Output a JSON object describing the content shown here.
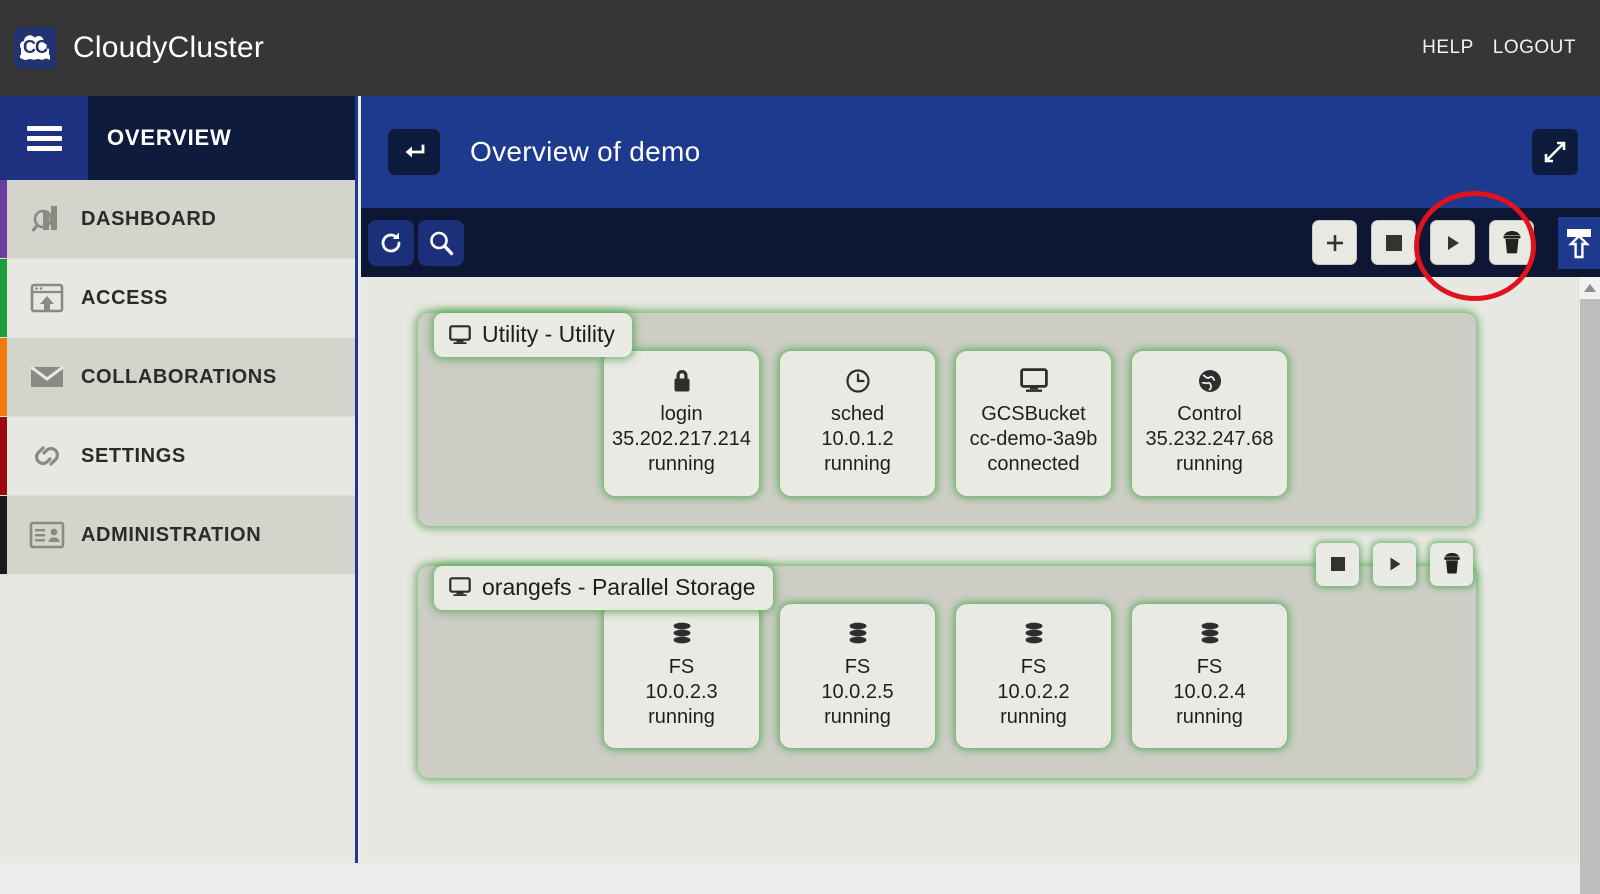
{
  "app": {
    "brand_name": "CloudyCluster",
    "logo_text": "CC",
    "logo_color": "#233270"
  },
  "topbar": {
    "help_label": "HELP",
    "logout_label": "LOGOUT",
    "background": "#363636"
  },
  "sidebar": {
    "menu_title": "OVERVIEW",
    "hamburger_icon": "hamburger-icon",
    "items": [
      {
        "label": "DASHBOARD",
        "icon": "dashboard-chart-magnifier-icon",
        "stripe": "#6b3fa0",
        "active": true
      },
      {
        "label": "ACCESS",
        "icon": "browser-upload-icon",
        "stripe": "#1f9e3c",
        "active": false
      },
      {
        "label": "COLLABORATIONS",
        "icon": "envelope-icon",
        "stripe": "#f07a10",
        "active": true
      },
      {
        "label": "SETTINGS",
        "icon": "chain-link-icon",
        "stripe": "#9c0a10",
        "active": false
      },
      {
        "label": "ADMINISTRATION",
        "icon": "id-card-icon",
        "stripe": "#1a1a1a",
        "active": true
      }
    ]
  },
  "page_header": {
    "title": "Overview of demo",
    "back_icon": "back-arrow-icon",
    "expand_icon": "expand-diagonal-icon",
    "background": "#1d3a8f"
  },
  "toolbar": {
    "background": "#0d1733",
    "left_buttons": [
      {
        "name": "refresh-button",
        "icon": "refresh-circular-arrow-icon"
      },
      {
        "name": "search-button",
        "icon": "search-magnifier-icon"
      }
    ],
    "right_buttons": [
      {
        "name": "add-button",
        "icon": "plus-icon",
        "label": "+"
      },
      {
        "name": "stop-button",
        "icon": "stop-square-icon"
      },
      {
        "name": "start-button",
        "icon": "play-triangle-icon"
      },
      {
        "name": "delete-button",
        "icon": "trash-can-icon",
        "highlighted": true
      }
    ],
    "upload_button": {
      "name": "upload-button",
      "icon": "upload-tray-icon"
    },
    "annotation": {
      "shape": "circle",
      "color": "#e1121b",
      "target": "delete-button"
    }
  },
  "panels": [
    {
      "tab_icon": "monitor-icon",
      "tab_label": "Utility - Utility",
      "actions": [],
      "nodes": [
        {
          "icon": "lock-icon",
          "name": "login",
          "address": "35.202.217.214",
          "status": "running"
        },
        {
          "icon": "clock-icon",
          "name": "sched",
          "address": "10.0.1.2",
          "status": "running"
        },
        {
          "icon": "monitor-icon",
          "name": "GCSBucket",
          "address": "cc-demo-3a9b",
          "status": "connected"
        },
        {
          "icon": "globe-icon",
          "name": "Control",
          "address": "35.232.247.68",
          "status": "running"
        }
      ]
    },
    {
      "tab_icon": "monitor-icon",
      "tab_label": "orangefs - Parallel Storage",
      "actions": [
        {
          "name": "panel-stop-button",
          "icon": "stop-square-icon"
        },
        {
          "name": "panel-start-button",
          "icon": "play-triangle-icon"
        },
        {
          "name": "panel-delete-button",
          "icon": "trash-can-icon"
        }
      ],
      "nodes": [
        {
          "icon": "database-stack-icon",
          "name": "FS",
          "address": "10.0.2.3",
          "status": "running"
        },
        {
          "icon": "database-stack-icon",
          "name": "FS",
          "address": "10.0.2.5",
          "status": "running"
        },
        {
          "icon": "database-stack-icon",
          "name": "FS",
          "address": "10.0.2.2",
          "status": "running"
        },
        {
          "icon": "database-stack-icon",
          "name": "FS",
          "address": "10.0.2.4",
          "status": "running"
        }
      ]
    }
  ],
  "scrollbar": {
    "up_arrow_icon": "caret-up-icon"
  },
  "theme": {
    "accent_blue": "#1d3a8f",
    "dark_navy": "#0d1733",
    "panel_glow_green": "#50a550",
    "content_bg": "#e8e8e2",
    "card_bg": "#eaeae4"
  }
}
